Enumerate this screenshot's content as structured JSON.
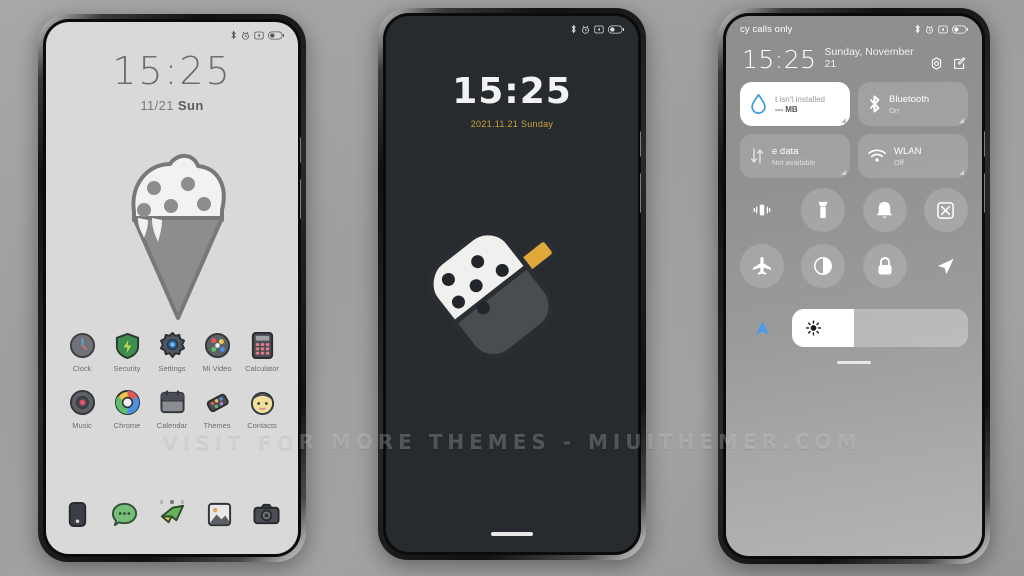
{
  "watermark": "VISIT FOR MORE THEMES - MIUITHEMER.COM",
  "theme": {
    "accent_gold": "#c9a23c",
    "accent_blue": "#3b9ddd",
    "wall1_bg": "#d9d9d9",
    "wall2_bg": "#272a2e",
    "page_bg": "#a0a0a0"
  },
  "phone1": {
    "name": "home-screen",
    "statusbar": {
      "icons": [
        "bluetooth-icon",
        "alarm-icon",
        "mute-icon",
        "battery-icon"
      ]
    },
    "clock": {
      "time": "15:25",
      "date": "11/21",
      "weekday": "Sun"
    },
    "wallpaper": "ice-cream-cone",
    "app_rows": [
      [
        {
          "label": "Clock",
          "icon": "clock-icon"
        },
        {
          "label": "Security",
          "icon": "shield-icon"
        },
        {
          "label": "Settings",
          "icon": "gear-icon"
        },
        {
          "label": "Mi Video",
          "icon": "video-icon"
        },
        {
          "label": "Calculator",
          "icon": "calculator-icon"
        }
      ],
      [
        {
          "label": "Music",
          "icon": "music-icon"
        },
        {
          "label": "Chrome",
          "icon": "chrome-icon"
        },
        {
          "label": "Calendar",
          "icon": "calendar-icon"
        },
        {
          "label": "Themes",
          "icon": "themes-icon"
        },
        {
          "label": "Contacts",
          "icon": "contacts-icon"
        }
      ]
    ],
    "page_dots": {
      "count": 3,
      "active_index": 1
    },
    "dock": [
      {
        "name": "phone-icon"
      },
      {
        "name": "messages-icon"
      },
      {
        "name": "browser-icon"
      },
      {
        "name": "gallery-icon"
      },
      {
        "name": "camera-icon"
      }
    ]
  },
  "phone2": {
    "name": "lock-screen",
    "statusbar": {
      "icons": [
        "bluetooth-icon",
        "alarm-icon",
        "mute-icon",
        "battery-icon"
      ]
    },
    "clock": {
      "time": "15:25",
      "date": "2021.11.21 Sunday"
    },
    "wallpaper": "popsicle"
  },
  "phone3": {
    "name": "control-center",
    "statusbar": {
      "carrier": "cy calls only",
      "icons": [
        "bluetooth-icon",
        "alarm-icon",
        "mute-icon",
        "battery-icon"
      ]
    },
    "header": {
      "time": "15:25",
      "date": "Sunday, November 21",
      "settings_icon": "gear-icon",
      "edit_icon": "edit-icon"
    },
    "tiles": [
      {
        "title": "t isn't installed",
        "sub": "--- MB",
        "icon": "water-drop-icon",
        "active": true,
        "name": "data-usage-tile"
      },
      {
        "title": "Bluetooth",
        "sub": "On",
        "icon": "bluetooth-icon",
        "active": false,
        "name": "bluetooth-tile"
      },
      {
        "title": "e data",
        "sub": "Not available",
        "icon": "data-arrows-icon",
        "active": false,
        "name": "mobile-data-tile"
      },
      {
        "title": "WLAN",
        "sub": "Off",
        "icon": "wifi-icon",
        "active": false,
        "name": "wlan-tile"
      }
    ],
    "toggles": [
      [
        {
          "icon": "vibrate-icon",
          "name": "vibrate-toggle",
          "plain": true
        },
        {
          "icon": "flashlight-icon",
          "name": "flashlight-toggle",
          "plain": false
        },
        {
          "icon": "bell-icon",
          "name": "ringtone-toggle",
          "plain": false
        },
        {
          "icon": "screenshot-icon",
          "name": "screenshot-toggle",
          "plain": false
        }
      ],
      [
        {
          "icon": "airplane-icon",
          "name": "airplane-mode-toggle",
          "plain": false
        },
        {
          "icon": "dark-mode-icon",
          "name": "dark-mode-toggle",
          "plain": false
        },
        {
          "icon": "lock-icon",
          "name": "lock-toggle",
          "plain": false
        },
        {
          "icon": "location-icon",
          "name": "location-toggle",
          "plain": true
        }
      ]
    ],
    "bottom_row": {
      "nav_icon": "navigation-arrow-icon",
      "brightness_icon": "brightness-icon",
      "brightness_percent": 35
    }
  }
}
